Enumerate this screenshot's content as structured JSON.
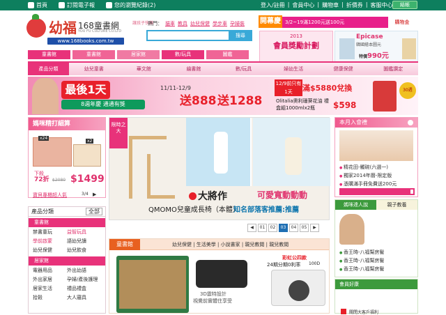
{
  "topbar": {
    "home": "首頁",
    "subscribe": "訂閱電子報",
    "history": "您的瀏覽紀錄(2)",
    "links": [
      "登入/註冊",
      "會員中心",
      "購物車",
      "折價券",
      "客服中心"
    ],
    "checkout": "結帳"
  },
  "logo": {
    "name": "幼福",
    "site": "168童書網",
    "company": "YOU FU CULTURE CO.LTD",
    "url": "www.168books.com.tw",
    "slogan": "讓孩子快樂"
  },
  "search": {
    "hot_label": "熱門：",
    "hot_words": [
      "貓車",
      "教具",
      "幼兒保健",
      "學步車",
      "孕婦裝"
    ],
    "button": "搜尋",
    "placeholder": ""
  },
  "ad_top": {
    "tag": "開幕慶",
    "text": "3/2~19滿1200元送100元",
    "side": "購物金"
  },
  "ad_left": {
    "year": "2013",
    "title": "會員獎勵計劃"
  },
  "ad_right": {
    "brand": "Epicase",
    "sub": "韓國繪本圖元",
    "price": "990元",
    "prefix": "特價"
  },
  "cat_tabs": [
    {
      "label": "童書館",
      "color": "#e8327a"
    },
    {
      "label": "童書館",
      "color": "#e8327a"
    },
    {
      "label": "居家館",
      "color": "#e8327a"
    },
    {
      "label": "數/玩具",
      "color": "#e8327a"
    },
    {
      "label": "圖鑑",
      "color": "#e8327a"
    }
  ],
  "main_nav": {
    "first": "產品分類",
    "items": [
      "幼兒童書",
      "華文館",
      "繪書館",
      "數/玩具",
      "婦幼生活",
      "健康保健",
      "圖鑑讚定"
    ]
  },
  "banner": {
    "headline": "最後1天",
    "sub": "8週年慶 通通有獎",
    "date": "11/11-12/9",
    "amt1": "送888",
    "amt2": "送1288",
    "badge": "12/9前只有1天",
    "badge2": "滿$5880兌換",
    "prod": "Olitalia奧利珊葵花油 禮盒組1000mlx2瓶",
    "price": "$598",
    "seal": "30週"
  },
  "promo": {
    "title": "媽咪精打細算",
    "x24": "x24",
    "x2": "x2",
    "disc_label": "下殺",
    "disc": "72折",
    "old_price": "$2080",
    "price": "$1499",
    "keyword": "寶貝專櫃超人氣",
    "page": "3/4",
    "nav": "▶"
  },
  "left_menu": {
    "title": "產品分類",
    "all": "全部",
    "sec1": "童書館",
    "items1": [
      "禁書童玩",
      "益智玩具",
      "學前啟蒙",
      "語幼兒讀",
      "幼兒保健",
      "幼兒飲食"
    ],
    "sec2": "居家館",
    "items2": [
      "電器用品",
      "外出幼語",
      "外出家居",
      "孕婦/產後護理",
      "居家生活",
      "禮品禮盒",
      "拾穀",
      "大人寢具"
    ]
  },
  "slider": {
    "tag": "限時之大",
    "brand": "大將作",
    "product": "QMOMO兒童成長椅（本體）",
    "right1": "可愛寬動動動",
    "right2": "知名部落客推薦:推薦",
    "pages": [
      "◀",
      "01",
      "02",
      "03",
      "04",
      "05",
      "▶"
    ],
    "current": "03"
  },
  "books": {
    "title": "童書館",
    "links": "幼兒保健 | 生活美學 | 小說書家 | 親兒教閱 | 親兒教閱",
    "dev_text1": "3D震特設計",
    "dev_text2": "視覺前實體住享受",
    "cam_tag": "彩虹公四款",
    "cam_text": "24期分期0利率",
    "cam_spec": "100D"
  },
  "right_new": {
    "title": "本月入會禮",
    "items": [
      "精花田-觸碗(六選一)",
      "獨家2014年曆-限定版",
      "憑購滿手冊免費送200元"
    ]
  },
  "right_feature": {
    "tab1": "媽咪達人說",
    "tab2": "親子教養",
    "items": [
      "香王時-八福幫房鬢",
      "香王時-八福幫房鬢",
      "香王時-八福幫房鬢"
    ]
  },
  "right_member": {
    "title": "會員好康",
    "text": "關閉大客戶福利"
  }
}
